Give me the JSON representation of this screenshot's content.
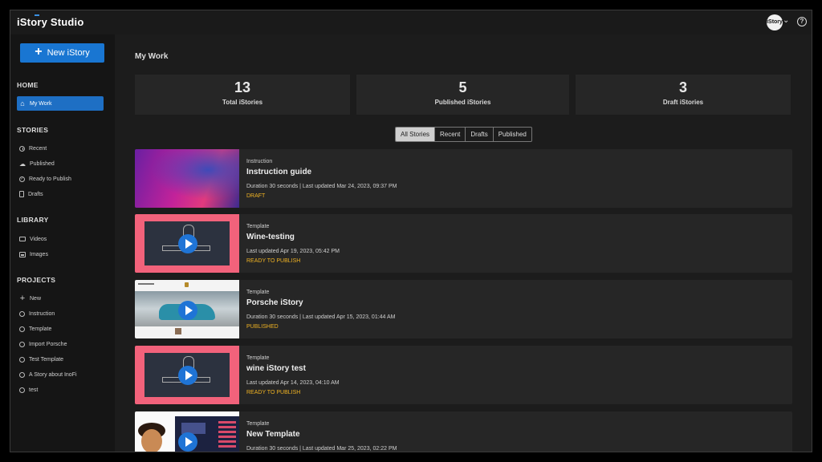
{
  "app": {
    "logo": "iStory Studio",
    "avatar_text": "iStory",
    "help": "?"
  },
  "sidebar": {
    "new_button": "New iStory",
    "sections": {
      "home": "HOME",
      "stories": "STORIES",
      "library": "LIBRARY",
      "projects": "PROJECTS"
    },
    "home_items": [
      {
        "label": "My Work",
        "icon": "home-icon"
      }
    ],
    "story_items": [
      {
        "label": "Recent",
        "icon": "clock-icon"
      },
      {
        "label": "Published",
        "icon": "cloud-icon"
      },
      {
        "label": "Ready to Publish",
        "icon": "check-circle-icon"
      },
      {
        "label": "Drafts",
        "icon": "document-icon"
      }
    ],
    "library_items": [
      {
        "label": "Videos",
        "icon": "video-icon"
      },
      {
        "label": "Images",
        "icon": "image-icon"
      }
    ],
    "project_items": [
      {
        "label": "New",
        "icon": "plus-icon"
      },
      {
        "label": "Instruction",
        "icon": "circle-icon"
      },
      {
        "label": "Template",
        "icon": "circle-icon"
      },
      {
        "label": "Import Porsche",
        "icon": "circle-icon"
      },
      {
        "label": "Test Template",
        "icon": "circle-icon"
      },
      {
        "label": "A Story about InoFi",
        "icon": "circle-icon"
      },
      {
        "label": "test",
        "icon": "circle-icon"
      }
    ]
  },
  "main": {
    "title": "My Work",
    "stats": [
      {
        "value": "13",
        "label": "Total iStories"
      },
      {
        "value": "5",
        "label": "Published iStories"
      },
      {
        "value": "3",
        "label": "Draft iStories"
      }
    ],
    "filters": [
      "All Stories",
      "Recent",
      "Drafts",
      "Published"
    ],
    "active_filter": "All Stories",
    "stories": [
      {
        "type": "Instruction",
        "title": "Instruction guide",
        "meta": "Duration 30 seconds | Last updated Mar 24, 2023, 09:37 PM",
        "status": "DRAFT"
      },
      {
        "type": "Template",
        "title": "Wine-testing",
        "meta": "Last updated Apr 19, 2023, 05:42 PM",
        "status": "READY TO PUBLISH"
      },
      {
        "type": "Template",
        "title": "Porsche iStory",
        "meta": "Duration 30 seconds | Last updated Apr 15, 2023, 01:44 AM",
        "status": "PUBLISHED"
      },
      {
        "type": "Template",
        "title": "wine iStory test",
        "meta": "Last updated Apr 14, 2023, 04:10 AM",
        "status": "READY TO PUBLISH"
      },
      {
        "type": "Template",
        "title": "New Template",
        "meta": "Duration 30 seconds | Last updated Mar 25, 2023, 02:22 PM",
        "status": ""
      }
    ]
  },
  "colors": {
    "accent": "#1976d2",
    "status": "#f0b323",
    "card": "#262626",
    "background": "#1c1c1c"
  }
}
